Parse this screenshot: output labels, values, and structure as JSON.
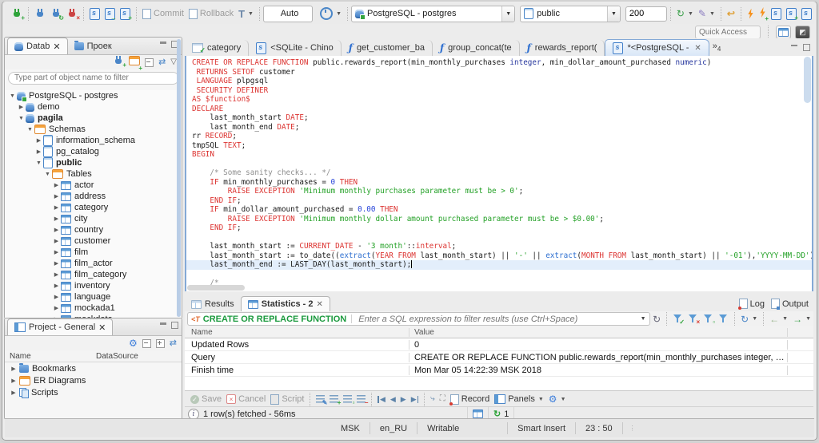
{
  "quick_access": {
    "placeholder": "Quick Access"
  },
  "main_toolbar": {
    "commit": "Commit",
    "rollback": "Rollback",
    "tx_letter": "T",
    "auto": "Auto",
    "connection": "PostgreSQL - postgres",
    "schema": "public",
    "fetch_size": "200"
  },
  "sidebar": {
    "tabs": [
      {
        "label": "Datab",
        "active": true
      },
      {
        "label": "Проек",
        "active": false
      }
    ],
    "filter_placeholder": "Type part of object name to filter",
    "tree": [
      {
        "label": "PostgreSQL - postgres",
        "level": 0,
        "state": "expanded",
        "icon": "database-connection",
        "bold": false
      },
      {
        "label": "demo",
        "level": 1,
        "state": "collapsed",
        "icon": "database",
        "bold": false
      },
      {
        "label": "pagila",
        "level": 1,
        "state": "expanded",
        "icon": "database",
        "bold": true
      },
      {
        "label": "Schemas",
        "level": 2,
        "state": "expanded",
        "icon": "schemas-folder",
        "bold": false
      },
      {
        "label": "information_schema",
        "level": 3,
        "state": "collapsed",
        "icon": "schema",
        "bold": false
      },
      {
        "label": "pg_catalog",
        "level": 3,
        "state": "collapsed",
        "icon": "schema",
        "bold": false
      },
      {
        "label": "public",
        "level": 3,
        "state": "expanded",
        "icon": "schema",
        "bold": true
      },
      {
        "label": "Tables",
        "level": 4,
        "state": "expanded",
        "icon": "tables-folder",
        "bold": false
      },
      {
        "label": "actor",
        "level": 5,
        "state": "collapsed",
        "icon": "table",
        "bold": false
      },
      {
        "label": "address",
        "level": 5,
        "state": "collapsed",
        "icon": "table",
        "bold": false
      },
      {
        "label": "category",
        "level": 5,
        "state": "collapsed",
        "icon": "table",
        "bold": false
      },
      {
        "label": "city",
        "level": 5,
        "state": "collapsed",
        "icon": "table",
        "bold": false
      },
      {
        "label": "country",
        "level": 5,
        "state": "collapsed",
        "icon": "table",
        "bold": false
      },
      {
        "label": "customer",
        "level": 5,
        "state": "collapsed",
        "icon": "table",
        "bold": false
      },
      {
        "label": "film",
        "level": 5,
        "state": "collapsed",
        "icon": "table",
        "bold": false
      },
      {
        "label": "film_actor",
        "level": 5,
        "state": "collapsed",
        "icon": "table",
        "bold": false
      },
      {
        "label": "film_category",
        "level": 5,
        "state": "collapsed",
        "icon": "table",
        "bold": false
      },
      {
        "label": "inventory",
        "level": 5,
        "state": "collapsed",
        "icon": "table",
        "bold": false
      },
      {
        "label": "language",
        "level": 5,
        "state": "collapsed",
        "icon": "table",
        "bold": false
      },
      {
        "label": "mockada1",
        "level": 5,
        "state": "collapsed",
        "icon": "table",
        "bold": false
      },
      {
        "label": "mockdata",
        "level": 5,
        "state": "collapsed",
        "icon": "table",
        "bold": false
      }
    ]
  },
  "project_panel": {
    "title": "Project - General",
    "columns": [
      "Name",
      "DataSource"
    ],
    "items": [
      {
        "label": "Bookmarks",
        "icon": "bookmarks-folder"
      },
      {
        "label": "ER Diagrams",
        "icon": "er-diagrams"
      },
      {
        "label": "Scripts",
        "icon": "scripts"
      }
    ]
  },
  "editor": {
    "tabs": [
      {
        "label": "category",
        "icon": "data-grid",
        "active": false
      },
      {
        "label": "<SQLite - Chino",
        "icon": "sql-script",
        "active": false
      },
      {
        "label": "get_customer_ba",
        "icon": "function",
        "active": false
      },
      {
        "label": "group_concat(te",
        "icon": "function",
        "active": false
      },
      {
        "label": "rewards_report(",
        "icon": "function",
        "active": false
      },
      {
        "label": "*<PostgreSQL - ",
        "icon": "sql-script",
        "active": true
      }
    ],
    "hidden_tabs_count": "4",
    "active_line": 23,
    "code": [
      [
        {
          "t": "CREATE OR REPLACE FUNCTION",
          "c": "k"
        },
        {
          "t": " public.rewards_report(min_monthly_purchases "
        },
        {
          "t": "integer",
          "c": "y"
        },
        {
          "t": ", min_dollar_amount_purchased "
        },
        {
          "t": "numeric",
          "c": "y"
        },
        {
          "t": ")"
        }
      ],
      [
        {
          "t": " "
        },
        {
          "t": "RETURNS SETOF",
          "c": "k"
        },
        {
          "t": " customer"
        }
      ],
      [
        {
          "t": " "
        },
        {
          "t": "LANGUAGE",
          "c": "k"
        },
        {
          "t": " plpgsql"
        }
      ],
      [
        {
          "t": " "
        },
        {
          "t": "SECURITY DEFINER",
          "c": "k"
        }
      ],
      [
        {
          "t": "AS $function$",
          "c": "k"
        }
      ],
      [
        {
          "t": "DECLARE",
          "c": "k"
        }
      ],
      [
        {
          "t": "    last_month_start "
        },
        {
          "t": "DATE",
          "c": "k"
        },
        {
          "t": ";"
        }
      ],
      [
        {
          "t": "    last_month_end "
        },
        {
          "t": "DATE",
          "c": "k"
        },
        {
          "t": ";"
        }
      ],
      [
        {
          "t": "rr "
        },
        {
          "t": "RECORD",
          "c": "k"
        },
        {
          "t": ";"
        }
      ],
      [
        {
          "t": "tmpSQL "
        },
        {
          "t": "TEXT",
          "c": "k"
        },
        {
          "t": ";"
        }
      ],
      [
        {
          "t": "BEGIN",
          "c": "k"
        }
      ],
      [],
      [
        {
          "t": "    "
        },
        {
          "t": "/* Some sanity checks... */",
          "c": "c"
        }
      ],
      [
        {
          "t": "    "
        },
        {
          "t": "IF",
          "c": "k"
        },
        {
          "t": " min_monthly_purchases = "
        },
        {
          "t": "0",
          "c": "n"
        },
        {
          "t": " "
        },
        {
          "t": "THEN",
          "c": "k"
        }
      ],
      [
        {
          "t": "        "
        },
        {
          "t": "RAISE EXCEPTION",
          "c": "k"
        },
        {
          "t": " "
        },
        {
          "t": "'Minimum monthly purchases parameter must be > 0'",
          "c": "s"
        },
        {
          "t": ";"
        }
      ],
      [
        {
          "t": "    "
        },
        {
          "t": "END IF",
          "c": "k"
        },
        {
          "t": ";"
        }
      ],
      [
        {
          "t": "    "
        },
        {
          "t": "IF",
          "c": "k"
        },
        {
          "t": " min_dollar_amount_purchased = "
        },
        {
          "t": "0.00",
          "c": "n"
        },
        {
          "t": " "
        },
        {
          "t": "THEN",
          "c": "k"
        }
      ],
      [
        {
          "t": "        "
        },
        {
          "t": "RAISE EXCEPTION",
          "c": "k"
        },
        {
          "t": " "
        },
        {
          "t": "'Minimum monthly dollar amount purchased parameter must be > $0.00'",
          "c": "s"
        },
        {
          "t": ";"
        }
      ],
      [
        {
          "t": "    "
        },
        {
          "t": "END IF",
          "c": "k"
        },
        {
          "t": ";"
        }
      ],
      [],
      [
        {
          "t": "    last_month_start := "
        },
        {
          "t": "CURRENT_DATE",
          "c": "k"
        },
        {
          "t": " - "
        },
        {
          "t": "'3 month'",
          "c": "s"
        },
        {
          "t": "::"
        },
        {
          "t": "interval",
          "c": "k"
        },
        {
          "t": ";"
        }
      ],
      [
        {
          "t": "    last_month_start := to_date(("
        },
        {
          "t": "extract",
          "c": "f"
        },
        {
          "t": "("
        },
        {
          "t": "YEAR FROM",
          "c": "k"
        },
        {
          "t": " last_month_start) || "
        },
        {
          "t": "'-'",
          "c": "s"
        },
        {
          "t": " || "
        },
        {
          "t": "extract",
          "c": "f"
        },
        {
          "t": "("
        },
        {
          "t": "MONTH FROM",
          "c": "k"
        },
        {
          "t": " last_month_start) || "
        },
        {
          "t": "'-01'",
          "c": "s"
        },
        {
          "t": "),"
        },
        {
          "t": "'YYYY-MM-DD'",
          "c": "s"
        },
        {
          "t": ");"
        }
      ],
      [
        {
          "t": "    last_month_end := LAST_DAY(last_month_start);"
        }
      ],
      [],
      [
        {
          "t": "    "
        },
        {
          "t": "/*",
          "c": "c"
        }
      ]
    ]
  },
  "results": {
    "tabs": [
      {
        "label": "Results",
        "active": false
      },
      {
        "label": "Statistics - 2",
        "active": true
      }
    ],
    "log_label": "Log",
    "output_label": "Output",
    "filter_prefix": "CREATE OR REPLACE FUNCTION",
    "filter_placeholder": "Enter a SQL expression to filter results (use Ctrl+Space)",
    "grid": {
      "columns": [
        "Name",
        "Value"
      ],
      "rows": [
        [
          "Updated Rows",
          "0"
        ],
        [
          "Query",
          "CREATE OR REPLACE FUNCTION public.rewards_report(min_monthly_purchases integer, min_dollar_amount_purcha..."
        ],
        [
          "Finish time",
          "Mon Mar 05 14:22:39 MSK 2018"
        ]
      ]
    },
    "toolbar": {
      "save": "Save",
      "cancel": "Cancel",
      "script": "Script",
      "record": "Record",
      "panels": "Panels"
    },
    "status": "1 row(s) fetched - 56ms",
    "exec_count": "1"
  },
  "statusbar": {
    "items": [
      "MSK",
      "en_RU",
      "Writable",
      "Smart Insert",
      "23 : 50"
    ]
  }
}
